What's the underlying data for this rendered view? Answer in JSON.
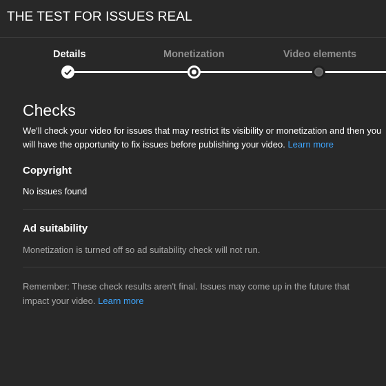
{
  "header": {
    "title": "THE TEST FOR ISSUES REAL"
  },
  "stepper": {
    "steps": [
      {
        "label": "Details",
        "state": "done",
        "icon": "check-icon"
      },
      {
        "label": "Monetization",
        "state": "current"
      },
      {
        "label": "Video elements",
        "state": "pending"
      }
    ]
  },
  "checks": {
    "heading": "Checks",
    "description": "We'll check your video for issues that may restrict its visibility or monetization and then you will have the opportunity to fix issues before publishing your video.",
    "learn_more": "Learn more",
    "copyright": {
      "heading": "Copyright",
      "status": "No issues found"
    },
    "ad_suitability": {
      "heading": "Ad suitability",
      "status": "Monetization is turned off so ad suitability check will not run."
    },
    "note": "Remember: These check results aren't final. Issues may come up in the future that impact your video.",
    "note_link": "Learn more"
  },
  "colors": {
    "background": "#282828",
    "link": "#3ea6ff",
    "muted_text": "#aaaaaa"
  }
}
